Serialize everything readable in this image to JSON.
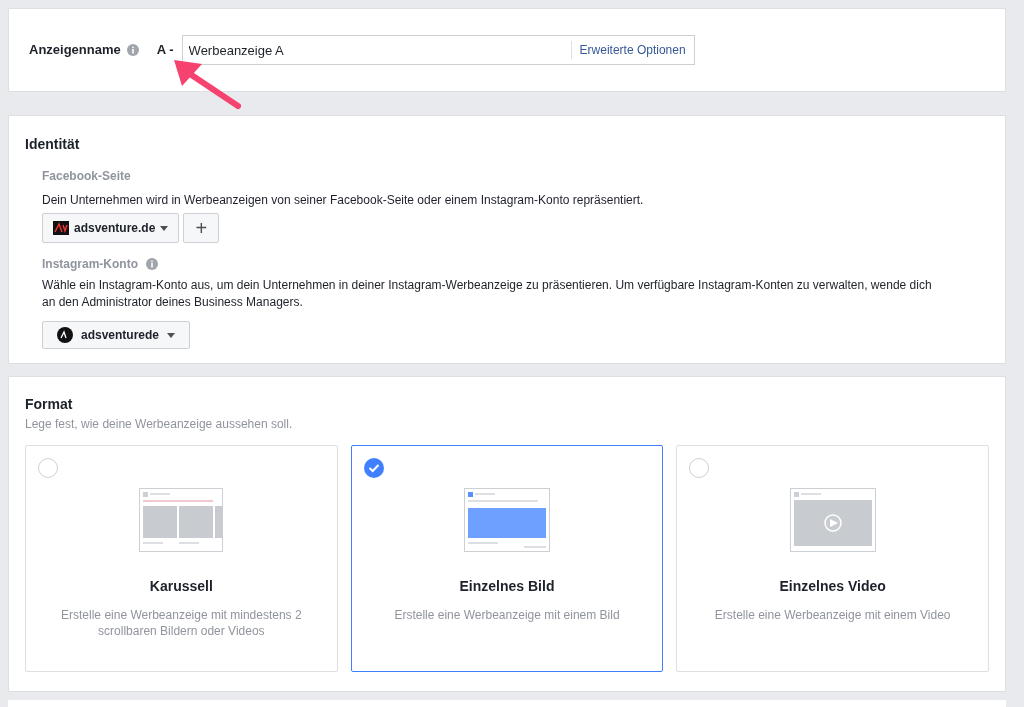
{
  "ad_name": {
    "label": "Anzeigenname",
    "prefix": "A -",
    "value": "Werbeanzeige A",
    "advanced_link": "Erweiterte Optionen"
  },
  "identity": {
    "title": "Identität",
    "facebook_page": {
      "label": "Facebook-Seite",
      "description": "Dein Unternehmen wird in Werbeanzeigen von seiner Facebook-Seite oder einem Instagram-Konto repräsentiert.",
      "selected_page": "adsventure.de",
      "add_button": "+"
    },
    "instagram_account": {
      "label": "Instagram-Konto",
      "description": "Wähle ein Instagram-Konto aus, um dein Unternehmen in deiner Instagram-Werbeanzeige zu präsentieren. Um verfügbare Instagram-Konten zu verwalten, wende dich an den Administrator deines Business Managers.",
      "selected_account": "adsventurede"
    }
  },
  "format": {
    "title": "Format",
    "subtitle": "Lege fest, wie deine Werbeanzeige aussehen soll.",
    "options": [
      {
        "kind": "carousel",
        "title": "Karussell",
        "description": "Erstelle eine Werbeanzeige mit mindestens 2 scrollbaren Bildern oder Videos",
        "selected": false
      },
      {
        "kind": "image",
        "title": "Einzelnes Bild",
        "description": "Erstelle eine Werbeanzeige mit einem Bild",
        "selected": true
      },
      {
        "kind": "video",
        "title": "Einzelnes Video",
        "description": "Erstelle eine Werbeanzeige mit einem Video",
        "selected": false
      }
    ]
  }
}
